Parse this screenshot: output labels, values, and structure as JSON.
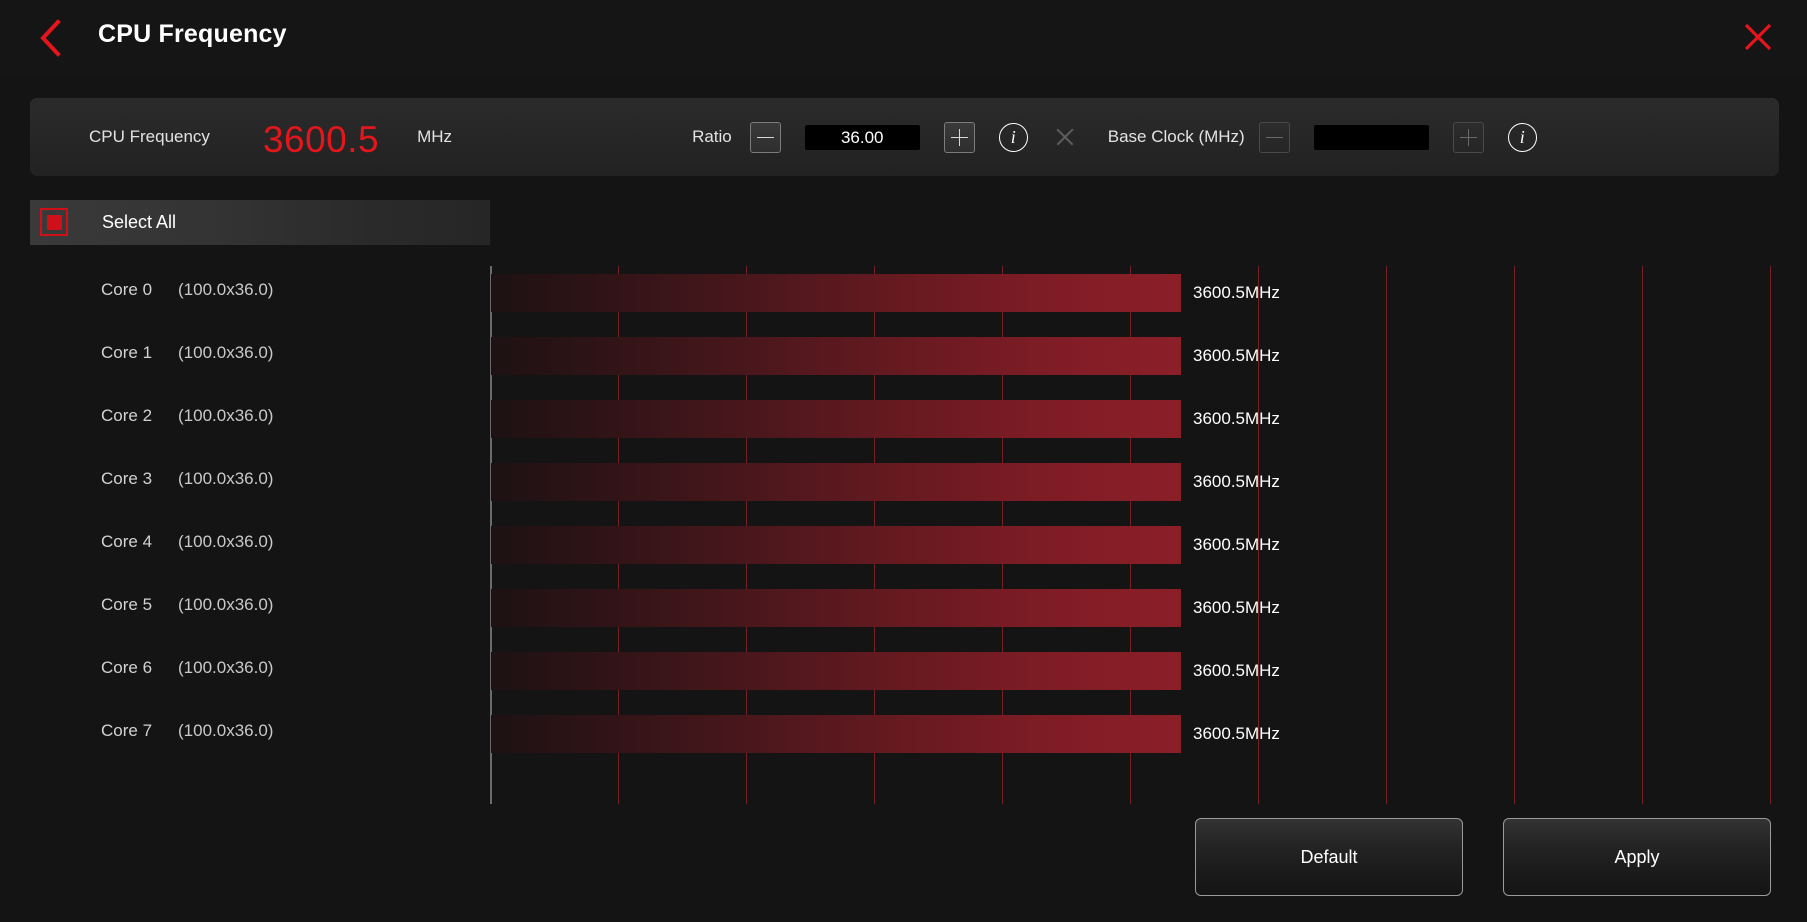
{
  "header": {
    "title": "CPU Frequency",
    "back_icon": "chevron-left-icon",
    "close_icon": "close-x-icon",
    "accent_color": "#e4161b"
  },
  "control_bar": {
    "cpu_frequency_label": "CPU Frequency",
    "cpu_frequency_value": "3600.5",
    "cpu_frequency_unit": "MHz",
    "ratio": {
      "label": "Ratio",
      "minus_label": "−",
      "plus_label": "+",
      "value": "36.00",
      "placeholder": "",
      "info_label": "i"
    },
    "separator": "×",
    "base_clock": {
      "label": "Base Clock (MHz)",
      "minus_label": "−",
      "plus_label": "+",
      "value": "",
      "placeholder": "",
      "info_label": "i"
    }
  },
  "select_all": {
    "label": "Select All",
    "checked": true,
    "checkbox_color": "#cf1019"
  },
  "cores": [
    {
      "name": "Core 0",
      "ratio": "(100.0x36.0)",
      "frequency": "3600.5MHz"
    },
    {
      "name": "Core 1",
      "ratio": "(100.0x36.0)",
      "frequency": "3600.5MHz"
    },
    {
      "name": "Core 2",
      "ratio": "(100.0x36.0)",
      "frequency": "3600.5MHz"
    },
    {
      "name": "Core 3",
      "ratio": "(100.0x36.0)",
      "frequency": "3600.5MHz"
    },
    {
      "name": "Core 4",
      "ratio": "(100.0x36.0)",
      "frequency": "3600.5MHz"
    },
    {
      "name": "Core 5",
      "ratio": "(100.0x36.0)",
      "frequency": "3600.5MHz"
    },
    {
      "name": "Core 6",
      "ratio": "(100.0x36.0)",
      "frequency": "3600.5MHz"
    },
    {
      "name": "Core 7",
      "ratio": "(100.0x36.0)",
      "frequency": "3600.5MHz"
    }
  ],
  "chart_data": {
    "type": "bar",
    "orientation": "horizontal",
    "title": "",
    "xlabel": "",
    "ylabel": "",
    "categories": [
      "Core 0",
      "Core 1",
      "Core 2",
      "Core 3",
      "Core 4",
      "Core 5",
      "Core 6",
      "Core 7"
    ],
    "values": [
      3600.5,
      3600.5,
      3600.5,
      3600.5,
      3600.5,
      3600.5,
      3600.5,
      3600.5
    ],
    "value_labels": [
      "3600.5MHz",
      "3600.5MHz",
      "3600.5MHz",
      "3600.5MHz",
      "3600.5MHz",
      "3600.5MHz",
      "3600.5MHz",
      "3600.5MHz"
    ],
    "unit": "MHz",
    "xlim": [
      0,
      10000
    ],
    "grid": true,
    "gridline_count": 10,
    "legend": "none",
    "bar_color": "#8b1f28"
  },
  "footer": {
    "default_label": "Default",
    "apply_label": "Apply"
  }
}
